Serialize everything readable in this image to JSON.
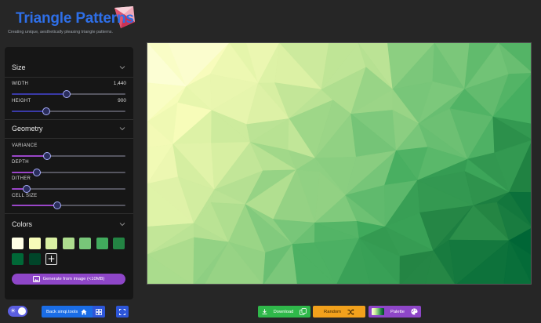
{
  "app": {
    "title": "Triangle Patterns",
    "subtitle": "Creating unique, aesthetically pleasing triangle patterns."
  },
  "sidebar": {
    "size": {
      "heading": "Size",
      "width_label": "WIDTH",
      "width_value": "1,440",
      "width_level": 0.48,
      "height_label": "HEIGHT",
      "height_value": "900",
      "height_level": 0.3
    },
    "geometry": {
      "heading": "Geometry",
      "variance_label": "VARIANCE",
      "variance_level": 0.31,
      "depth_label": "DEPTH",
      "depth_level": 0.22,
      "dither_label": "DITHER",
      "dither_level": 0.13,
      "cell_size_label": "CELL SIZE",
      "cell_size_level": 0.4
    },
    "colors": {
      "heading": "Colors",
      "swatches": [
        "#ffffe5",
        "#f7fcb9",
        "#d9f0a3",
        "#addd8e",
        "#78c679",
        "#41ab5d",
        "#238443",
        "#006837",
        "#004529"
      ],
      "add_label": "+",
      "generate_label": "Generate from image  (<10MB)"
    }
  },
  "footer_left": {
    "back_label": "Back sinqi.tools"
  },
  "actions": {
    "download_label": "Download",
    "random_label": "Random",
    "palette_label": "Palette"
  },
  "accent_colors": {
    "title": "#2e6fe8",
    "download": "#2fb84a",
    "random": "#f2a11c",
    "palette": "#8e46c8"
  }
}
